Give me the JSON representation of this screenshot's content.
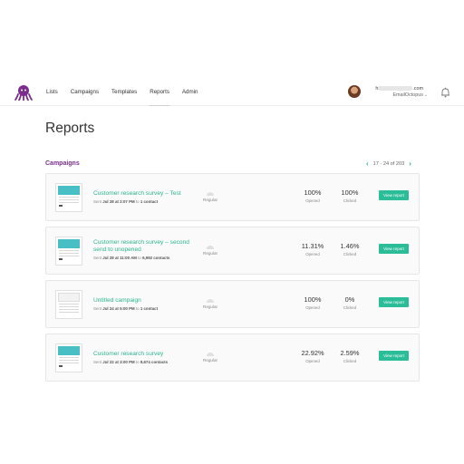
{
  "nav": {
    "items": [
      "Lists",
      "Campaigns",
      "Templates",
      "Reports",
      "Admin"
    ],
    "active": "Reports"
  },
  "user": {
    "email_prefix": "h",
    "email_suffix": ".com",
    "org": "EmailOctopus"
  },
  "page_title": "Reports",
  "section": {
    "label": "Campaigns",
    "pagination": "17 - 24 of 203"
  },
  "campaigns": [
    {
      "name_line1": "Customer research survey – Test",
      "name_line2": "",
      "meta_prefix": "Sent",
      "meta_date": "Jul 28 at 2:07 PM",
      "meta_to": "to",
      "meta_count": "1 contact",
      "type": "Regular",
      "opened": "100%",
      "opened_label": "Opened",
      "clicked": "100%",
      "clicked_label": "Clicked",
      "button": "View report",
      "thumb_style": "teal"
    },
    {
      "name_line1": "Customer research survey – second",
      "name_line2": "send to unopened",
      "meta_prefix": "Sent",
      "meta_date": "Jul 28 at 11:00 AM",
      "meta_to": "to",
      "meta_count": "6,992 contacts",
      "type": "Regular",
      "opened": "11.31%",
      "opened_label": "Opened",
      "clicked": "1.46%",
      "clicked_label": "Clicked",
      "button": "View report",
      "thumb_style": "teal"
    },
    {
      "name_line1": "Untitled campaign",
      "name_line2": "",
      "meta_prefix": "Sent",
      "meta_date": "Jul 24 at 5:00 PM",
      "meta_to": "to",
      "meta_count": "1 contact",
      "type": "Regular",
      "opened": "100%",
      "opened_label": "Opened",
      "clicked": "0%",
      "clicked_label": "Clicked",
      "button": "View report",
      "thumb_style": "gray"
    },
    {
      "name_line1": "Customer research survey",
      "name_line2": "",
      "meta_prefix": "Sent",
      "meta_date": "Jul 22 at 3:00 PM",
      "meta_to": "to",
      "meta_count": "9,674 contacts",
      "type": "Regular",
      "opened": "22.92%",
      "opened_label": "Opened",
      "clicked": "2.59%",
      "clicked_label": "Clicked",
      "button": "View report",
      "thumb_style": "teal"
    }
  ],
  "colors": {
    "brand_purple": "#7b2d8e",
    "accent_green": "#2bbd97",
    "link_green": "#2bb58e"
  },
  "icons": {
    "logo": "octopus-logo",
    "bell": "notification-bell-icon",
    "pager_prev": "chevron-left-icon",
    "pager_next": "chevron-right-icon",
    "type": "regular-campaign-icon"
  }
}
